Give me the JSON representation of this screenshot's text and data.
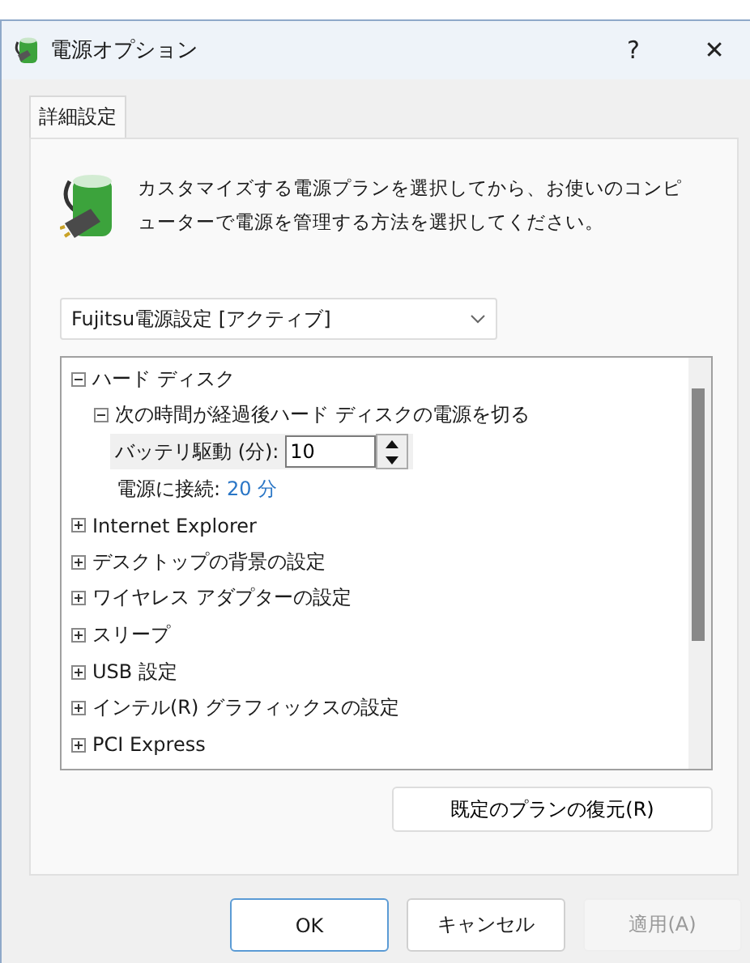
{
  "window": {
    "title": "電源オプション",
    "help": "?",
    "close": "✕"
  },
  "tabs": [
    {
      "label": "詳細設定",
      "selected": true
    }
  ],
  "description": "カスタマイズする電源プランを選択してから、お使いのコンピューターで電源を管理する方法を選択してください。",
  "plan_dropdown": {
    "value": "Fujitsu電源設定 [アクティブ]"
  },
  "tree": [
    {
      "kind": "group",
      "label": "ハード ディスク",
      "expanded": true,
      "children": [
        {
          "kind": "group",
          "label": "次の時間が経過後ハード ディスクの電源を切る",
          "expanded": true,
          "children": [
            {
              "kind": "spin",
              "label": "バッテリ駆動 (分):",
              "value": "10"
            },
            {
              "kind": "link",
              "label": "電源に接続:",
              "value": "20 分"
            }
          ]
        }
      ]
    },
    {
      "kind": "group",
      "label": "Internet Explorer",
      "expanded": false
    },
    {
      "kind": "group",
      "label": "デスクトップの背景の設定",
      "expanded": false
    },
    {
      "kind": "group",
      "label": "ワイヤレス アダプターの設定",
      "expanded": false
    },
    {
      "kind": "group",
      "label": "スリープ",
      "expanded": false
    },
    {
      "kind": "group",
      "label": "USB 設定",
      "expanded": false
    },
    {
      "kind": "group",
      "label": "インテル(R) グラフィックスの設定",
      "expanded": false
    },
    {
      "kind": "group",
      "label": "PCI Express",
      "expanded": false
    }
  ],
  "restore_button": "既定のプランの復元(R)",
  "buttons": [
    {
      "label": "OK",
      "disabled": false,
      "default": true
    },
    {
      "label": "キャンセル",
      "disabled": false,
      "default": false
    },
    {
      "label": "適用(A)",
      "disabled": true,
      "default": false
    }
  ]
}
